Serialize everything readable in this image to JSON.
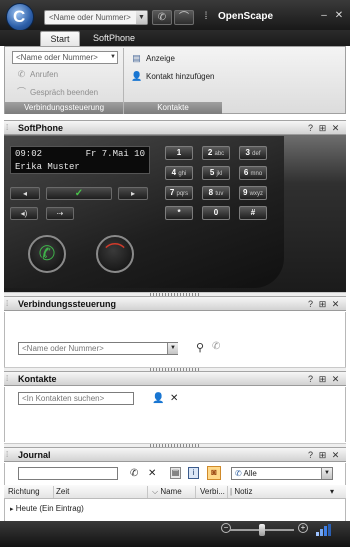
{
  "app": {
    "title": "OpenScape"
  },
  "titlebar": {
    "quick_dial_placeholder": "<Name oder Nummer>",
    "icons": [
      "handset-icon",
      "hangup-icon",
      "minimize-icon",
      "close-icon"
    ]
  },
  "ribbon": {
    "tabs": [
      {
        "label": "Start",
        "active": true
      },
      {
        "label": "SoftPhone",
        "active": false
      }
    ],
    "verbindung_group": {
      "combo_placeholder": "<Name oder Nummer>",
      "call_label": "Anrufen",
      "end_call_label": "Gespräch beenden",
      "group_label": "Verbindungssteuerung"
    },
    "kontakte_group": {
      "view_label": "Anzeige",
      "add_contact_label": "Kontakt hinzufügen",
      "group_label": "Kontakte"
    }
  },
  "softphone": {
    "title": "SoftPhone",
    "lcd": {
      "time": "09:02",
      "date": "Fr 7.Mai 10",
      "name": "Erika Muster"
    },
    "keypad": [
      {
        "num": "1",
        "letters": ""
      },
      {
        "num": "2",
        "letters": "abc"
      },
      {
        "num": "3",
        "letters": "def"
      },
      {
        "num": "4",
        "letters": "ghi"
      },
      {
        "num": "5",
        "letters": "jkl"
      },
      {
        "num": "6",
        "letters": "mno"
      },
      {
        "num": "7",
        "letters": "pqrs"
      },
      {
        "num": "8",
        "letters": "tuv"
      },
      {
        "num": "9",
        "letters": "wxyz"
      },
      {
        "num": "*",
        "letters": ""
      },
      {
        "num": "0",
        "letters": ""
      },
      {
        "num": "#",
        "letters": ""
      }
    ]
  },
  "verbindungssteuerung": {
    "title": "Verbindungssteuerung",
    "input_placeholder": "<Name oder Nummer>"
  },
  "kontakte": {
    "title": "Kontakte",
    "search_placeholder": "<In Kontakten suchen>"
  },
  "journal": {
    "title": "Journal",
    "filter_selected": "Alle",
    "columns": [
      "Richtung",
      "Zeit",
      "Name",
      "Verbi...",
      "Notiz"
    ],
    "groups": [
      {
        "label": "Heute (Ein Eintrag)"
      }
    ]
  },
  "panel_buttons": {
    "help": "?",
    "float": "⊞",
    "close": "✕"
  },
  "colors": {
    "call_green": "#3fb34a",
    "hangup_red": "#d23a2a",
    "chrome_dark": "#1c1c1c"
  }
}
